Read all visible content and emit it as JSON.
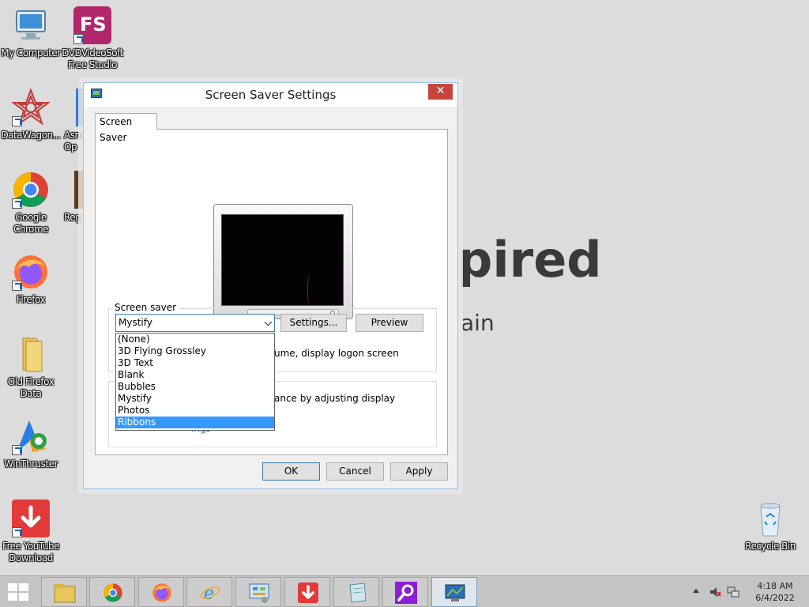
{
  "wallpaper": {
    "big_text": "pired",
    "small_text": "ain"
  },
  "desktop_icons": [
    {
      "label": "My Computer"
    },
    {
      "label": "DVDVideoSoft Free Studio",
      "badge": "FS"
    },
    {
      "label": "DataWagon..."
    },
    {
      "label": "Asm Op"
    },
    {
      "label": "Google Chrome"
    },
    {
      "label": "Reg"
    },
    {
      "label": "Firefox"
    },
    {
      "label": "Old Firefox Data"
    },
    {
      "label": "WinThruster"
    },
    {
      "label": "Free YouTube Download"
    },
    {
      "label": "Recycle Bin"
    }
  ],
  "dialog": {
    "title": "Screen Saver Settings",
    "close_glyph": "✕",
    "tab": "Screen Saver",
    "group_label": "Screen saver",
    "selected": "Mystify",
    "settings_label": "Settings...",
    "preview_label": "Preview",
    "logon_text": "ume, display logon screen",
    "power_text": "ance by adjusting display",
    "hidden_link_text": "ings",
    "options": [
      "(None)",
      "3D Flying Grossley",
      "3D Text",
      "Blank",
      "Bubbles",
      "Mystify",
      "Photos",
      "Ribbons"
    ],
    "highlighted_option": "Ribbons",
    "ok_label": "OK",
    "cancel_label": "Cancel",
    "apply_label": "Apply"
  },
  "taskbar": {
    "items": [
      "file-explorer-icon",
      "chrome-icon",
      "firefox-icon",
      "internet-explorer-icon",
      "control-panel-icon",
      "free-youtube-download-icon",
      "notepad-icon",
      "search-app-icon",
      "screen-saver-icon"
    ],
    "clock_time": "4:18 AM",
    "clock_date": "6/4/2022"
  },
  "colors": {
    "accent": "#3399ff",
    "close": "#c7453b",
    "taskbar": "#c4c4c4",
    "desktop": "#dcdcdc"
  }
}
